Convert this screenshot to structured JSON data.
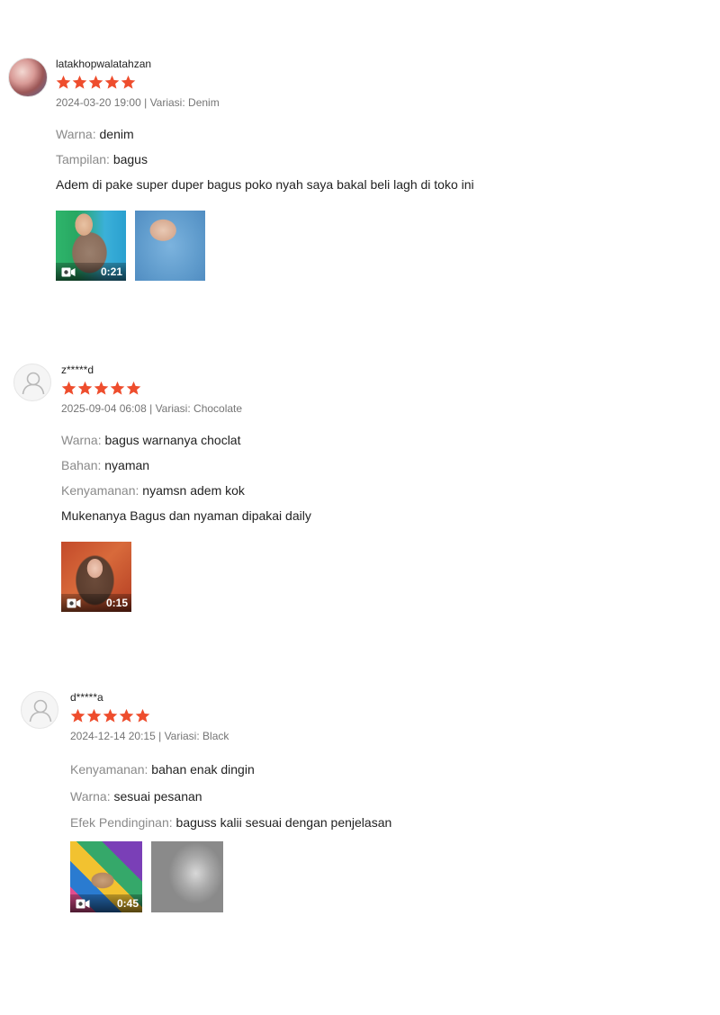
{
  "colors": {
    "star": "#ee4d2d",
    "meta_text": "#757575",
    "attr_key": "#8a8a8a"
  },
  "reviews": [
    {
      "username": "latakhopwalatahzan",
      "rating": 5,
      "date": "2024-03-20 19:00",
      "separator": "|",
      "variation_label": "Variasi:",
      "variation": "Denim",
      "attributes": [
        {
          "key": "Warna:",
          "value": "denim"
        },
        {
          "key": "Tampilan:",
          "value": "bagus"
        }
      ],
      "comment": "Adem di pake super duper bagus poko nyah saya bakal beli lagh di toko ini",
      "media": [
        {
          "type": "video",
          "duration": "0:21",
          "icon": "video-camera-icon"
        },
        {
          "type": "image"
        }
      ]
    },
    {
      "username": "z*****d",
      "rating": 5,
      "date": "2025-09-04 06:08",
      "separator": "|",
      "variation_label": "Variasi:",
      "variation": "Chocolate",
      "attributes": [
        {
          "key": "Warna:",
          "value": "bagus warnanya choclat"
        },
        {
          "key": "Bahan:",
          "value": "nyaman"
        },
        {
          "key": "Kenyamanan:",
          "value": "nyamsn adem kok"
        }
      ],
      "comment": "Mukenanya Bagus dan nyaman dipakai daily",
      "media": [
        {
          "type": "video",
          "duration": "0:15",
          "icon": "video-camera-icon"
        }
      ]
    },
    {
      "username": "d*****a",
      "rating": 5,
      "date": "2024-12-14 20:15",
      "separator": "|",
      "variation_label": "Variasi:",
      "variation": "Black",
      "attributes": [
        {
          "key": "Kenyamanan:",
          "value": "bahan enak dingin"
        },
        {
          "key": "Warna:",
          "value": "sesuai pesanan"
        },
        {
          "key": "Efek Pendinginan:",
          "value": "baguss kalii sesuai dengan penjelasan"
        }
      ],
      "comment": "",
      "media": [
        {
          "type": "video",
          "duration": "0:45",
          "icon": "video-camera-icon"
        },
        {
          "type": "image"
        }
      ]
    }
  ]
}
